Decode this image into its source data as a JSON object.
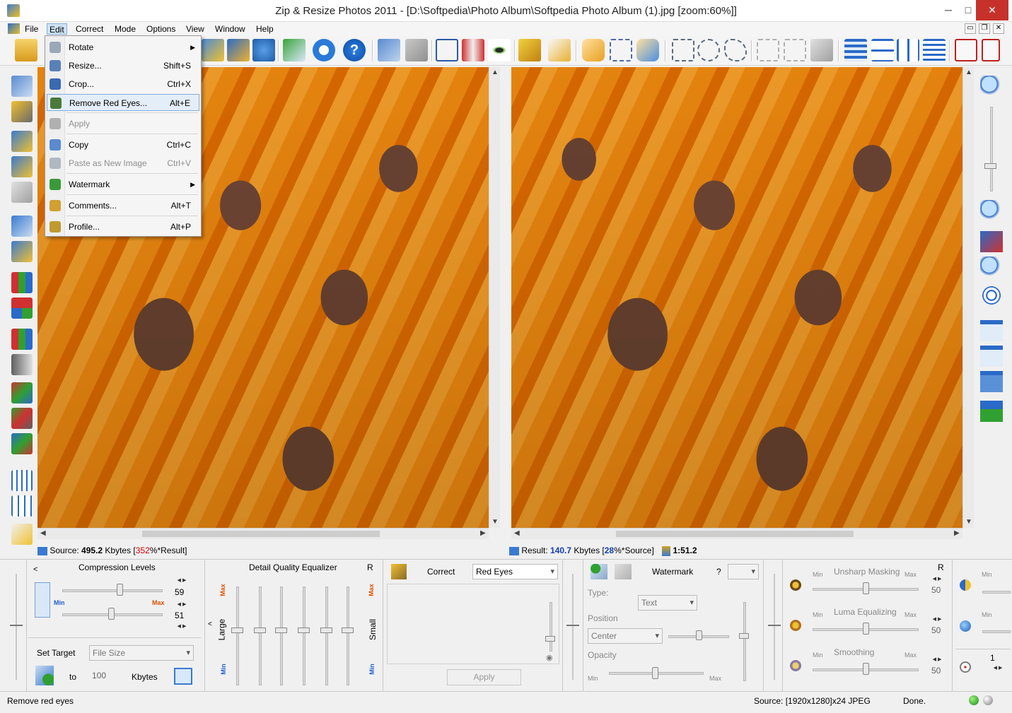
{
  "window": {
    "title": "Zip & Resize Photos 2011 - [D:\\Softpedia\\Photo Album\\Softpedia Photo Album (1).jpg  [zoom:60%]]",
    "minimize": "─",
    "maximize": "□",
    "close": "✕"
  },
  "menubar": {
    "items": [
      "File",
      "Edit",
      "Correct",
      "Mode",
      "Options",
      "View",
      "Window",
      "Help"
    ],
    "mdi": [
      "▭",
      "❐",
      "✕"
    ]
  },
  "edit_menu": {
    "items": [
      {
        "label": "Rotate",
        "shortcut": "",
        "submenu": "▶",
        "icon": "rotate-icon",
        "enabled": true
      },
      {
        "label": "Resize...",
        "shortcut": "Shift+S",
        "icon": "resize-icon",
        "enabled": true
      },
      {
        "label": "Crop...",
        "shortcut": "Ctrl+X",
        "icon": "crop-icon",
        "enabled": true
      },
      {
        "label": "Remove Red Eyes...",
        "shortcut": "Alt+E",
        "icon": "eye-icon",
        "enabled": true,
        "highlighted": true
      },
      {
        "label": "Apply",
        "shortcut": "",
        "icon": "apply-icon",
        "enabled": false
      },
      {
        "label": "Copy",
        "shortcut": "Ctrl+C",
        "icon": "copy-icon",
        "enabled": true
      },
      {
        "label": "Paste as New Image",
        "shortcut": "Ctrl+V",
        "icon": "paste-icon",
        "enabled": false
      },
      {
        "label": "Watermark",
        "shortcut": "",
        "submenu": "▶",
        "icon": "watermark-icon",
        "enabled": true
      },
      {
        "label": "Comments...",
        "shortcut": "Alt+T",
        "icon": "comments-icon",
        "enabled": true
      },
      {
        "label": "Profile...",
        "shortcut": "Alt+P",
        "icon": "profile-icon",
        "enabled": true
      }
    ]
  },
  "source_info": {
    "prefix": "Source: ",
    "size": "495.2",
    "unit": " Kbytes [",
    "pct": "352",
    "suffix": "%*Result]"
  },
  "result_info": {
    "prefix": "Result: ",
    "size": "140.7",
    "unit": " Kbytes [",
    "pct": "28",
    "suffix": "%*Source]",
    "time": "1:51.2"
  },
  "compression": {
    "title": "Compression Levels",
    "back": "<",
    "min": "Min",
    "max": "Max",
    "value1": "59",
    "value2": "51",
    "level1": 0.59,
    "level2": 0.51,
    "set_target": "Set Target",
    "target_mode": "File Size",
    "to": "to",
    "target_value": "100",
    "target_unit": "Kbytes"
  },
  "equalizer": {
    "title": "Detail Quality Equalizer",
    "r": "R",
    "max": "Max",
    "min": "Min",
    "large": "Large",
    "small": "Small",
    "caret": "<"
  },
  "correct": {
    "label": "Correct",
    "value": "Red Eyes",
    "apply": "Apply"
  },
  "watermark": {
    "title": "Watermark",
    "help": "?",
    "type_label": "Type:",
    "type_value": "Text",
    "position_label": "Position",
    "position_value": "Center",
    "opacity_label": "Opacity",
    "min": "Min",
    "max": "Max"
  },
  "filters": {
    "r": "R",
    "items": [
      {
        "name": "Unsharp Masking",
        "value": "50",
        "min": "Min",
        "max": "Max"
      },
      {
        "name": "Luma Equalizing",
        "value": "50",
        "min": "Min",
        "max": "Max"
      },
      {
        "name": "Smoothing",
        "value": "50",
        "min": "Min",
        "max": "Max"
      }
    ],
    "edge_min1": "Min",
    "edge_min2": "Min",
    "edge_value": "1"
  },
  "status": {
    "left": "Remove red eyes",
    "source": "Source: [1920x1280]x24 JPEG",
    "done": "Done."
  },
  "colors": {
    "accent": "#d00000",
    "result": "#1040b0",
    "photo_orange": "#f08000"
  }
}
